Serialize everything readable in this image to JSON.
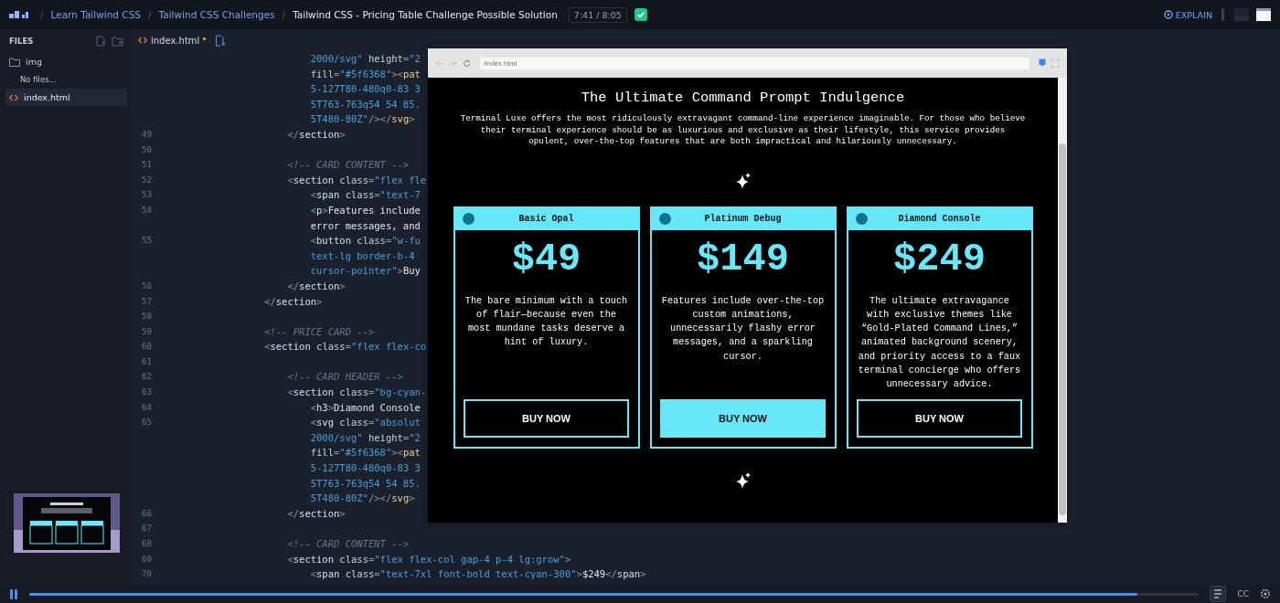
{
  "topbar": {
    "separator": "/",
    "breadcrumbs": [
      "Learn Tailwind CSS",
      "Tailwind CSS Challenges"
    ],
    "current": "Tailwind CSS - Pricing Table Challenge Possible Solution",
    "time": "7:41 / 8:05",
    "completed": true,
    "explain": "EXPLAIN"
  },
  "sidebar": {
    "title": "FILES",
    "items": [
      {
        "kind": "folder",
        "label": "img",
        "selected": false
      },
      {
        "kind": "note",
        "label": "No files...",
        "selected": false
      },
      {
        "kind": "file",
        "label": "index.html",
        "selected": true
      }
    ]
  },
  "editor": {
    "tab": {
      "label": "index.html",
      "modified": true
    },
    "lines": [
      {
        "code": [
          {
            "kind": "str",
            "t": "                        2000/svg\""
          },
          {
            "kind": "attr",
            "t": " height"
          },
          {
            "kind": "punct",
            "t": "="
          },
          {
            "kind": "str",
            "t": "\"2"
          }
        ]
      },
      {
        "code": [
          {
            "kind": "attr",
            "t": "                        fill"
          },
          {
            "kind": "punct",
            "t": "="
          },
          {
            "kind": "str",
            "t": "\"#5f6368\""
          },
          {
            "kind": "punct",
            "t": "><"
          },
          {
            "kind": "svgtag",
            "t": "pat"
          }
        ]
      },
      {
        "code": [
          {
            "kind": "str",
            "t": "                        5-127T80-480q0-83 3"
          }
        ]
      },
      {
        "code": [
          {
            "kind": "str",
            "t": "                        5T763-763q54 54 85."
          }
        ]
      },
      {
        "code": [
          {
            "kind": "str",
            "t": "                        5T480-80Z\""
          },
          {
            "kind": "punct",
            "t": "/></"
          },
          {
            "kind": "svgtag",
            "t": "svg"
          },
          {
            "kind": "punct",
            "t": ">"
          }
        ]
      },
      {
        "num": "49",
        "code": [
          {
            "kind": "punct",
            "t": "                    </"
          },
          {
            "kind": "tag",
            "t": "section"
          },
          {
            "kind": "punct",
            "t": ">"
          }
        ]
      },
      {
        "num": "50"
      },
      {
        "num": "51",
        "code": [
          {
            "kind": "comment",
            "t": "                    <!-- CARD CONTENT -->"
          }
        ]
      },
      {
        "num": "52",
        "code": [
          {
            "kind": "punct",
            "t": "                    <"
          },
          {
            "kind": "tag",
            "t": "section"
          },
          {
            "kind": "attr",
            "t": " class"
          },
          {
            "kind": "punct",
            "t": "="
          },
          {
            "kind": "str",
            "t": "\"flex fle"
          }
        ]
      },
      {
        "num": "53",
        "code": [
          {
            "kind": "punct",
            "t": "                        <"
          },
          {
            "kind": "tag",
            "t": "span"
          },
          {
            "kind": "attr",
            "t": " class"
          },
          {
            "kind": "punct",
            "t": "="
          },
          {
            "kind": "str",
            "t": "\"text-7"
          }
        ]
      },
      {
        "num": "54",
        "code": [
          {
            "kind": "punct",
            "t": "                        <"
          },
          {
            "kind": "tag",
            "t": "p"
          },
          {
            "kind": "punct",
            "t": ">"
          },
          {
            "kind": "text",
            "t": "Features include"
          }
        ]
      },
      {
        "code": [
          {
            "kind": "text",
            "t": "                        error messages, and"
          }
        ]
      },
      {
        "num": "55",
        "code": [
          {
            "kind": "punct",
            "t": "                        <"
          },
          {
            "kind": "tag",
            "t": "button"
          },
          {
            "kind": "attr",
            "t": " class"
          },
          {
            "kind": "punct",
            "t": "="
          },
          {
            "kind": "str",
            "t": "\"w-fu"
          }
        ]
      },
      {
        "code": [
          {
            "kind": "str",
            "t": "                        text-lg border-b-4"
          }
        ]
      },
      {
        "code": [
          {
            "kind": "str",
            "t": "                        cursor-pointer\""
          },
          {
            "kind": "punct",
            "t": ">"
          },
          {
            "kind": "text",
            "t": "Buy"
          }
        ]
      },
      {
        "num": "56",
        "code": [
          {
            "kind": "punct",
            "t": "                    </"
          },
          {
            "kind": "tag",
            "t": "section"
          },
          {
            "kind": "punct",
            "t": ">"
          }
        ]
      },
      {
        "num": "57",
        "code": [
          {
            "kind": "punct",
            "t": "                </"
          },
          {
            "kind": "tag",
            "t": "section"
          },
          {
            "kind": "punct",
            "t": ">"
          }
        ]
      },
      {
        "num": "58"
      },
      {
        "num": "59",
        "code": [
          {
            "kind": "comment",
            "t": "                <!-- PRICE CARD -->"
          }
        ]
      },
      {
        "num": "60",
        "code": [
          {
            "kind": "punct",
            "t": "                <"
          },
          {
            "kind": "tag",
            "t": "section"
          },
          {
            "kind": "attr",
            "t": " class"
          },
          {
            "kind": "punct",
            "t": "="
          },
          {
            "kind": "str",
            "t": "\"flex flex-co"
          }
        ]
      },
      {
        "num": "61"
      },
      {
        "num": "62",
        "code": [
          {
            "kind": "comment",
            "t": "                    <!-- CARD HEADER -->"
          }
        ]
      },
      {
        "num": "63",
        "code": [
          {
            "kind": "punct",
            "t": "                    <"
          },
          {
            "kind": "tag",
            "t": "section"
          },
          {
            "kind": "attr",
            "t": " class"
          },
          {
            "kind": "punct",
            "t": "="
          },
          {
            "kind": "str",
            "t": "\"bg-cyan-"
          }
        ]
      },
      {
        "num": "64",
        "code": [
          {
            "kind": "punct",
            "t": "                        <"
          },
          {
            "kind": "tag",
            "t": "h3"
          },
          {
            "kind": "punct",
            "t": ">"
          },
          {
            "kind": "text",
            "t": "Diamond Console"
          }
        ]
      },
      {
        "num": "65",
        "code": [
          {
            "kind": "punct",
            "t": "                        <"
          },
          {
            "kind": "tag",
            "t": "svg"
          },
          {
            "kind": "attr",
            "t": " class"
          },
          {
            "kind": "punct",
            "t": "="
          },
          {
            "kind": "str",
            "t": "\"absolut"
          }
        ]
      },
      {
        "code": [
          {
            "kind": "str",
            "t": "                        2000/svg\""
          },
          {
            "kind": "attr",
            "t": " height"
          },
          {
            "kind": "punct",
            "t": "="
          },
          {
            "kind": "str",
            "t": "\"2"
          }
        ]
      },
      {
        "code": [
          {
            "kind": "attr",
            "t": "                        fill"
          },
          {
            "kind": "punct",
            "t": "="
          },
          {
            "kind": "str",
            "t": "\"#5f6368\""
          },
          {
            "kind": "punct",
            "t": "><"
          },
          {
            "kind": "svgtag",
            "t": "pat"
          }
        ]
      },
      {
        "code": [
          {
            "kind": "str",
            "t": "                        5-127T80-480q0-83 3"
          }
        ]
      },
      {
        "code": [
          {
            "kind": "str",
            "t": "                        5T763-763q54 54 85."
          }
        ]
      },
      {
        "code": [
          {
            "kind": "str",
            "t": "                        5T480-80Z\""
          },
          {
            "kind": "punct",
            "t": "/></"
          },
          {
            "kind": "svgtag",
            "t": "svg"
          },
          {
            "kind": "punct",
            "t": ">"
          }
        ]
      },
      {
        "num": "66",
        "code": [
          {
            "kind": "punct",
            "t": "                    </"
          },
          {
            "kind": "tag",
            "t": "section"
          },
          {
            "kind": "punct",
            "t": ">"
          }
        ]
      },
      {
        "num": "67"
      },
      {
        "num": "68",
        "code": [
          {
            "kind": "comment",
            "t": "                    <!-- CARD CONTENT -->"
          }
        ]
      },
      {
        "num": "69",
        "code": [
          {
            "kind": "punct",
            "t": "                    <"
          },
          {
            "kind": "tag",
            "t": "section"
          },
          {
            "kind": "attr",
            "t": " class"
          },
          {
            "kind": "punct",
            "t": "="
          },
          {
            "kind": "str",
            "t": "\"flex flex-col gap-4 p-4 lg:grow\""
          },
          {
            "kind": "punct",
            "t": ">"
          }
        ]
      },
      {
        "num": "70",
        "code": [
          {
            "kind": "punct",
            "t": "                        <"
          },
          {
            "kind": "tag",
            "t": "span"
          },
          {
            "kind": "attr",
            "t": " class"
          },
          {
            "kind": "punct",
            "t": "="
          },
          {
            "kind": "str",
            "t": "\"text-7xl font-bold text-cyan-300\""
          },
          {
            "kind": "punct",
            "t": ">"
          },
          {
            "kind": "text",
            "t": "$249"
          },
          {
            "kind": "punct",
            "t": "</"
          },
          {
            "kind": "tag",
            "t": "span"
          },
          {
            "kind": "punct",
            "t": ">"
          }
        ]
      }
    ]
  },
  "preview": {
    "url": "/index.html",
    "title": "The Ultimate Command Prompt Indulgence",
    "intro": "Terminal Luxe offers the most ridiculously extravagant command-line experience imaginable. For those who believe their terminal experience should be as luxurious and exclusive as their lifestyle, this service provides opulent, over-the-top features that are both impractical and hilariously unnecessary.",
    "cards": [
      {
        "name": "Basic Opal",
        "price": "$49",
        "description": "The bare minimum with a touch of flair—because even the most mundane tasks deserve a hint of luxury.",
        "button": "BUY NOW",
        "hovered": false
      },
      {
        "name": "Platinum Debug",
        "price": "$149",
        "description": "Features include over-the-top custom animations, unnecessarily flashy error messages, and a sparkling cursor.",
        "button": "BUY NOW",
        "hovered": true
      },
      {
        "name": "Diamond Console",
        "price": "$249",
        "description": "The ultimate extravagance with exclusive themes like “Gold-Plated Command Lines,” animated background scenery, and priority access to a faux terminal concierge who offers unnecessary advice.",
        "button": "BUY NOW",
        "hovered": false
      }
    ]
  },
  "player": {
    "playing": true,
    "level": 0.947,
    "captions": "CC"
  }
}
